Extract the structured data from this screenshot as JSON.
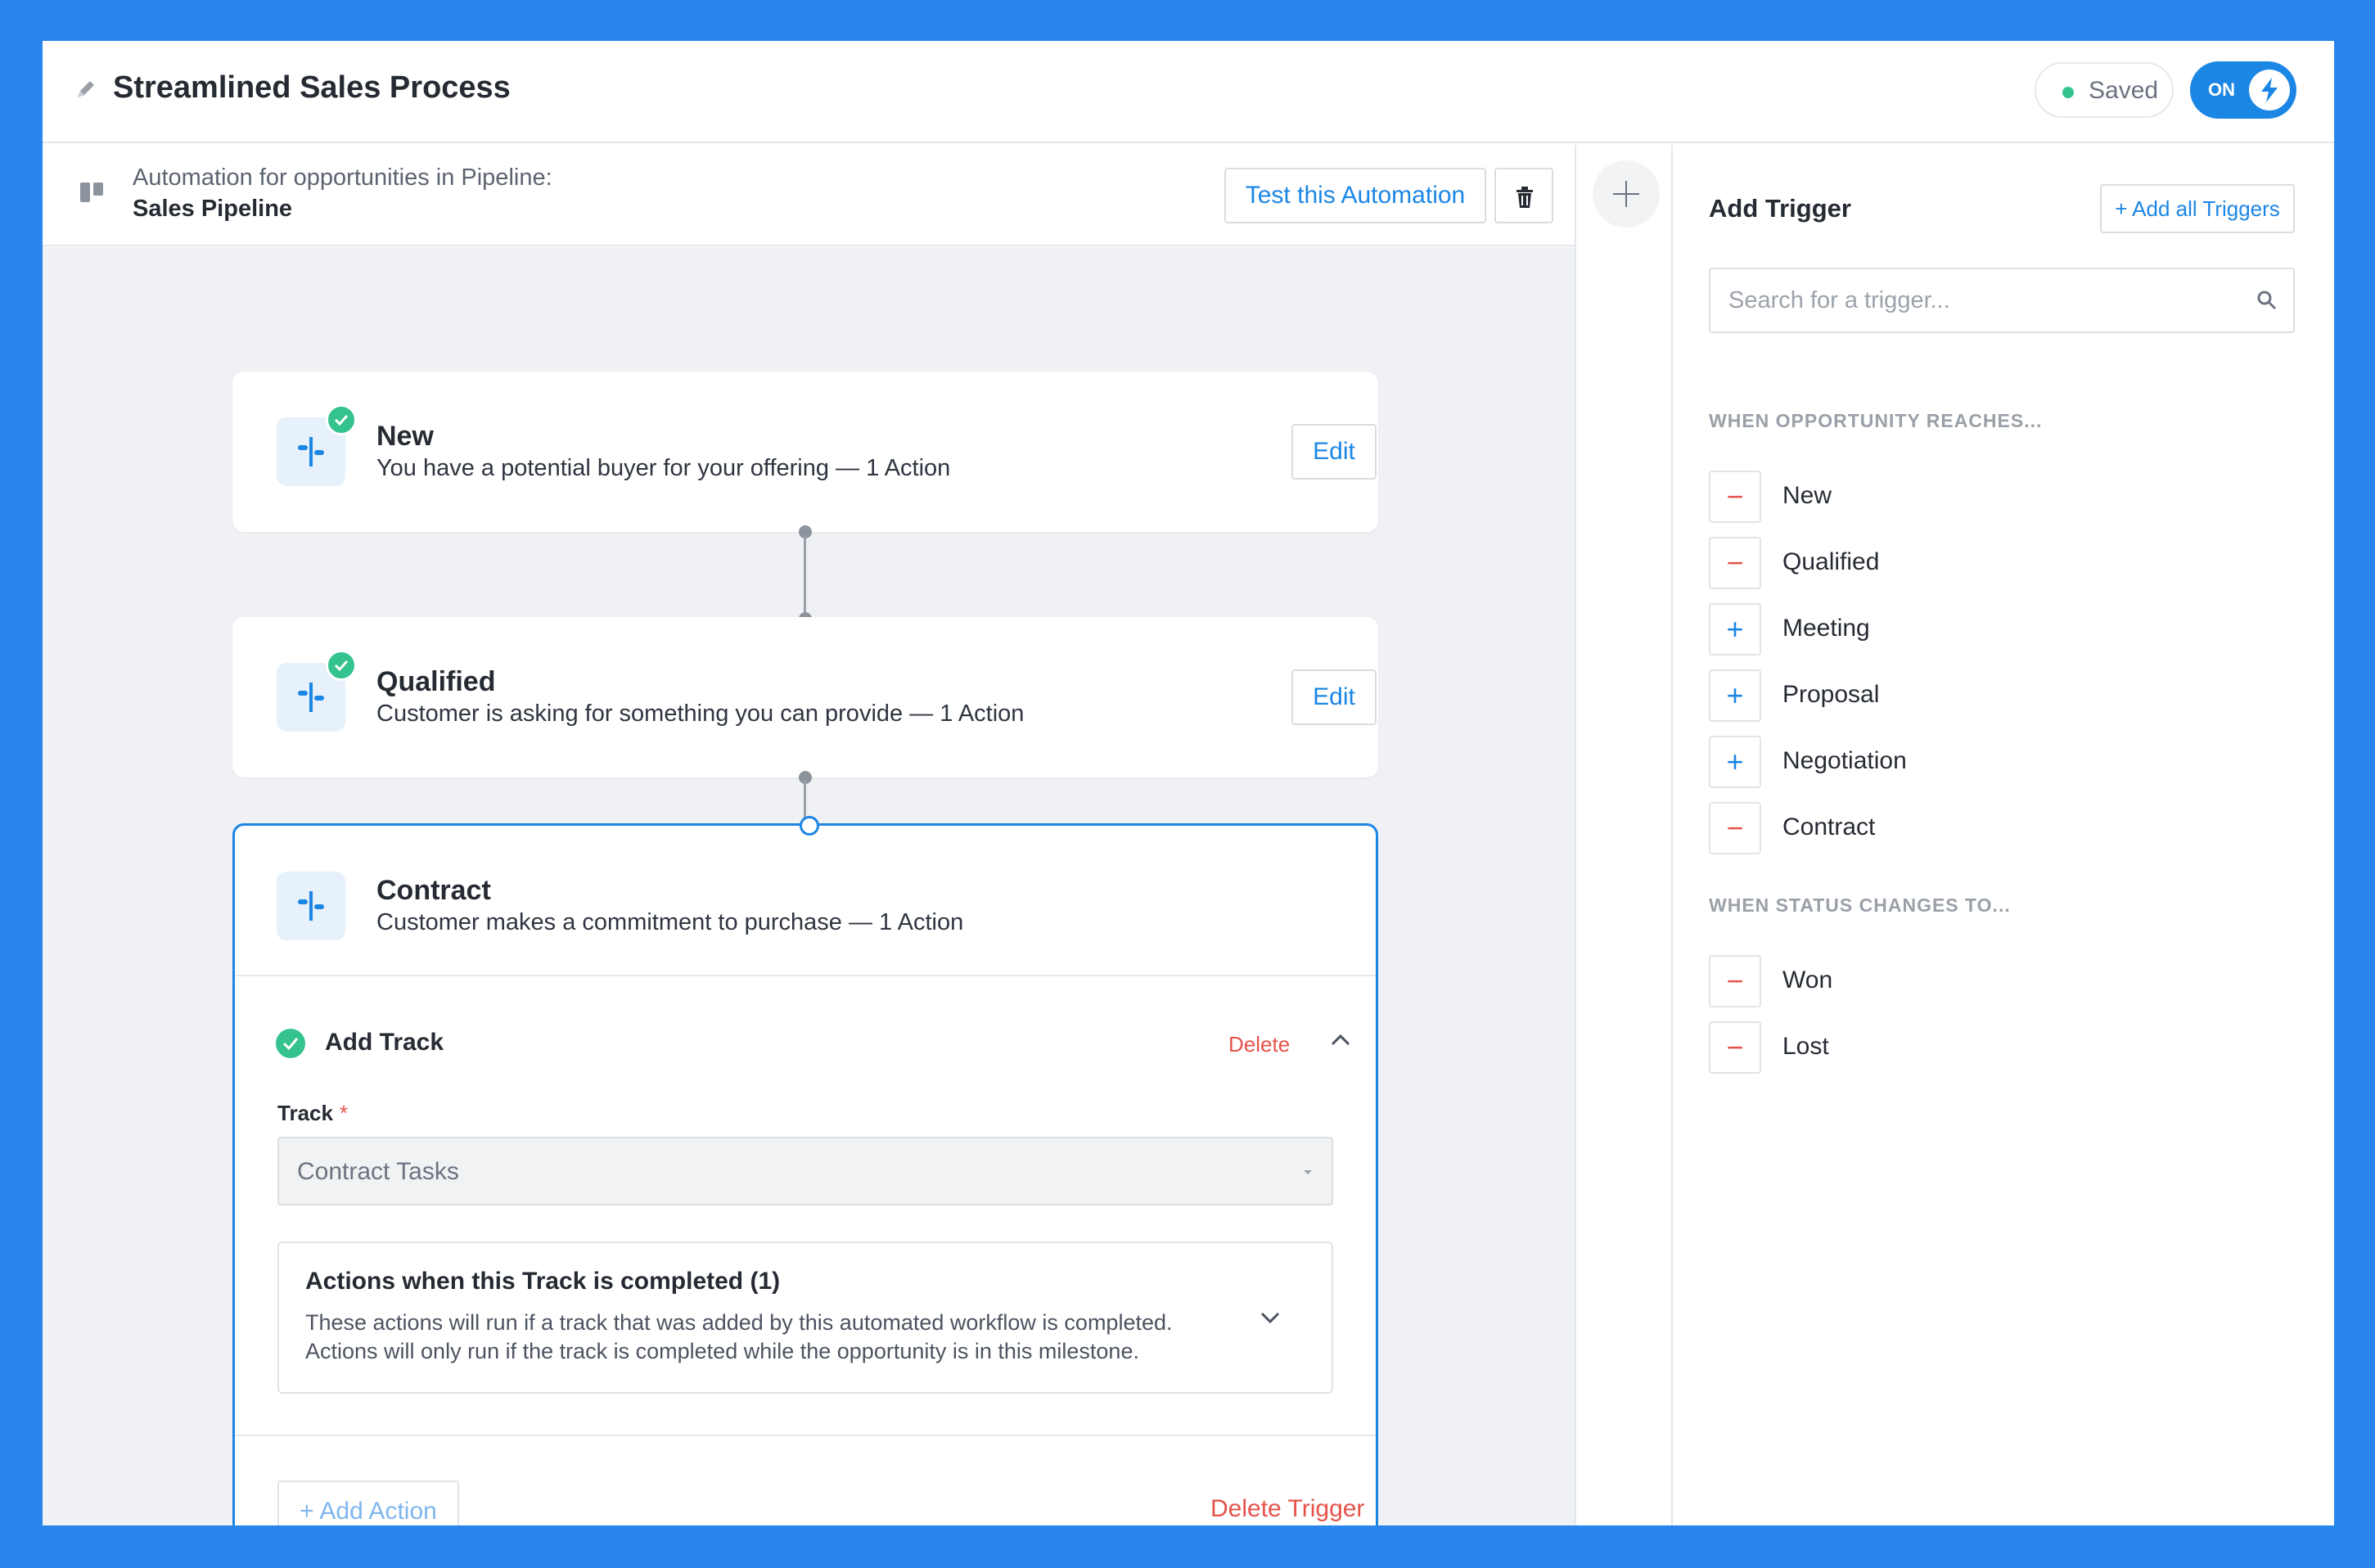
{
  "colors": {
    "background": "#2a86ec",
    "accent": "#1c86e4",
    "success": "#34c38f",
    "danger": "#e5534b"
  },
  "header": {
    "title": "Streamlined Sales Process",
    "saved_label": "Saved",
    "toggle_label": "ON",
    "toggle_state": "on"
  },
  "subheader": {
    "line1": "Automation for opportunities in Pipeline:",
    "pipeline": "Sales Pipeline",
    "test_button": "Test this Automation"
  },
  "stages": [
    {
      "title": "New",
      "description": "You have a potential buyer for your offering — 1 Action",
      "edit_label": "Edit",
      "complete": true
    },
    {
      "title": "Qualified",
      "description": "Customer is asking for something you can provide — 1 Action",
      "edit_label": "Edit",
      "complete": true
    },
    {
      "title": "Contract",
      "description": "Customer makes a commitment to purchase — 1 Action",
      "complete": false
    }
  ],
  "active_step": {
    "title": "Add Track",
    "delete_label": "Delete",
    "track_label": "Track",
    "required_marker": "*",
    "track_value": "Contract Tasks",
    "actions_title": "Actions when this Track is completed (1)",
    "actions_desc_line1": "These actions will run if a track that was added by this automated workflow is completed.",
    "actions_desc_line2": "Actions will only run if the track is completed while the opportunity is in this milestone.",
    "add_action_label": "+ Add Action",
    "delete_trigger_label": "Delete Trigger"
  },
  "panel": {
    "title": "Add Trigger",
    "add_all_label": "+ Add all Triggers",
    "search_placeholder": "Search for a trigger...",
    "section1_label": "WHEN OPPORTUNITY REACHES...",
    "section1_items": [
      {
        "name": "New",
        "symbol": "−",
        "state": "added"
      },
      {
        "name": "Qualified",
        "symbol": "−",
        "state": "added"
      },
      {
        "name": "Meeting",
        "symbol": "+",
        "state": "available"
      },
      {
        "name": "Proposal",
        "symbol": "+",
        "state": "available"
      },
      {
        "name": "Negotiation",
        "symbol": "+",
        "state": "available"
      },
      {
        "name": "Contract",
        "symbol": "−",
        "state": "added"
      }
    ],
    "section2_label": "WHEN STATUS CHANGES TO...",
    "section2_items": [
      {
        "name": "Won",
        "symbol": "−",
        "state": "added"
      },
      {
        "name": "Lost",
        "symbol": "−",
        "state": "added"
      }
    ]
  }
}
